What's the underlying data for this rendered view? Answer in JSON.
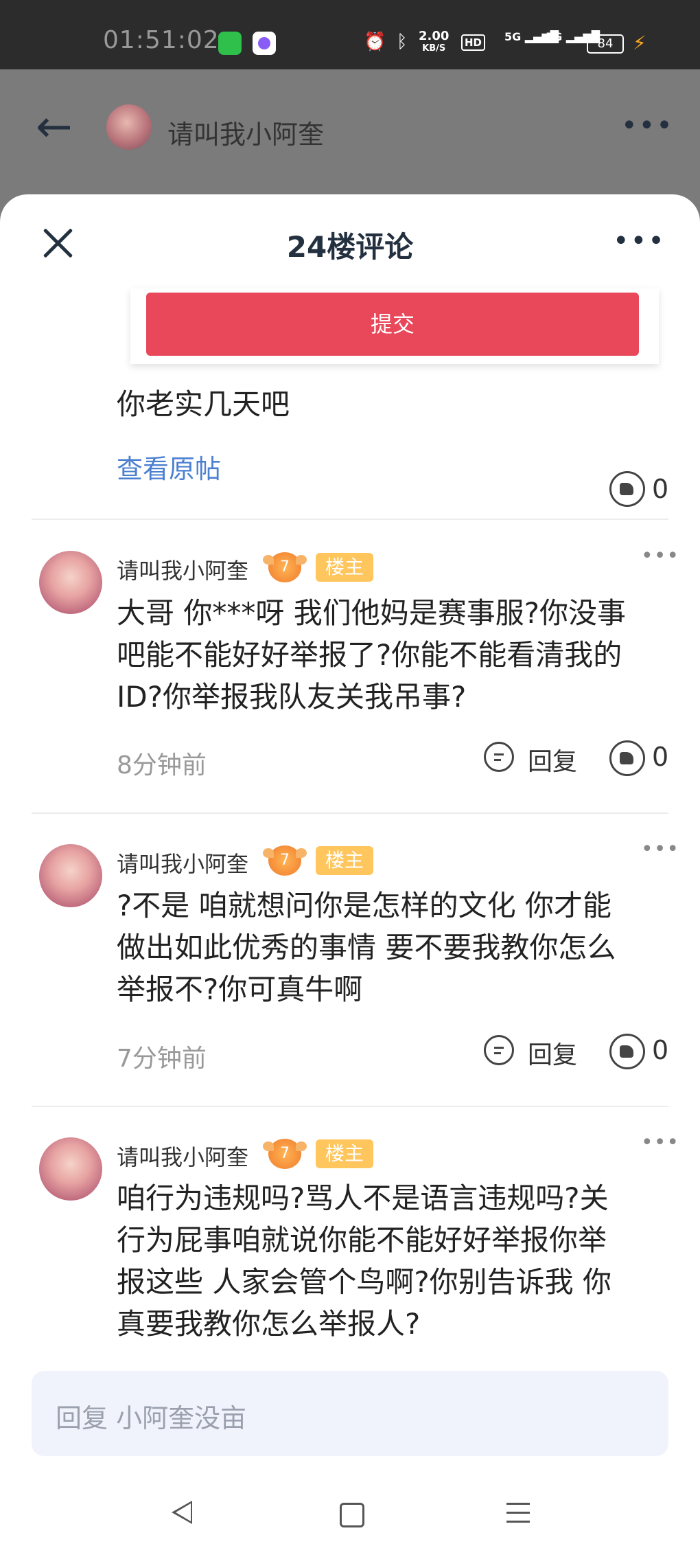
{
  "status_bar": {
    "time": "01:51:02",
    "net_speed": "2.00",
    "net_unit": "KB/S",
    "hd": "HD",
    "signal1": "5G",
    "signal2": "5G",
    "battery": "84"
  },
  "background_header": {
    "title": "请叫我小阿奎"
  },
  "sheet": {
    "title": "24楼评论",
    "submit_label": "提交"
  },
  "main_post": {
    "text": "你老实几天吧",
    "view_original": "查看原帖",
    "likes": "0"
  },
  "comments": [
    {
      "username": "请叫我小阿奎",
      "level": "7",
      "badge": "楼主",
      "lines": [
        "大哥 你***呀 我们他妈是赛事服?你没事",
        "吧能不能好好举报了?你能不能看清我的",
        "ID?你举报我队友关我吊事?"
      ],
      "time": "8分钟前",
      "reply_label": "回复",
      "likes": "0"
    },
    {
      "username": "请叫我小阿奎",
      "level": "7",
      "badge": "楼主",
      "lines": [
        "?不是 咱就想问你是怎样的文化 你才能",
        "做出如此优秀的事情 要不要我教你怎么",
        "举报不?你可真牛啊"
      ],
      "time": "7分钟前",
      "reply_label": "回复",
      "likes": "0"
    },
    {
      "username": "请叫我小阿奎",
      "level": "7",
      "badge": "楼主",
      "lines": [
        "咱行为违规吗?骂人不是语言违规吗?关",
        "行为屁事咱就说你能不能好好举报你举",
        "报这些 人家会管个鸟啊?你别告诉我 你",
        "真要我教你怎么举报人?"
      ]
    }
  ],
  "input": {
    "placeholder": "回复 小阿奎没亩"
  }
}
